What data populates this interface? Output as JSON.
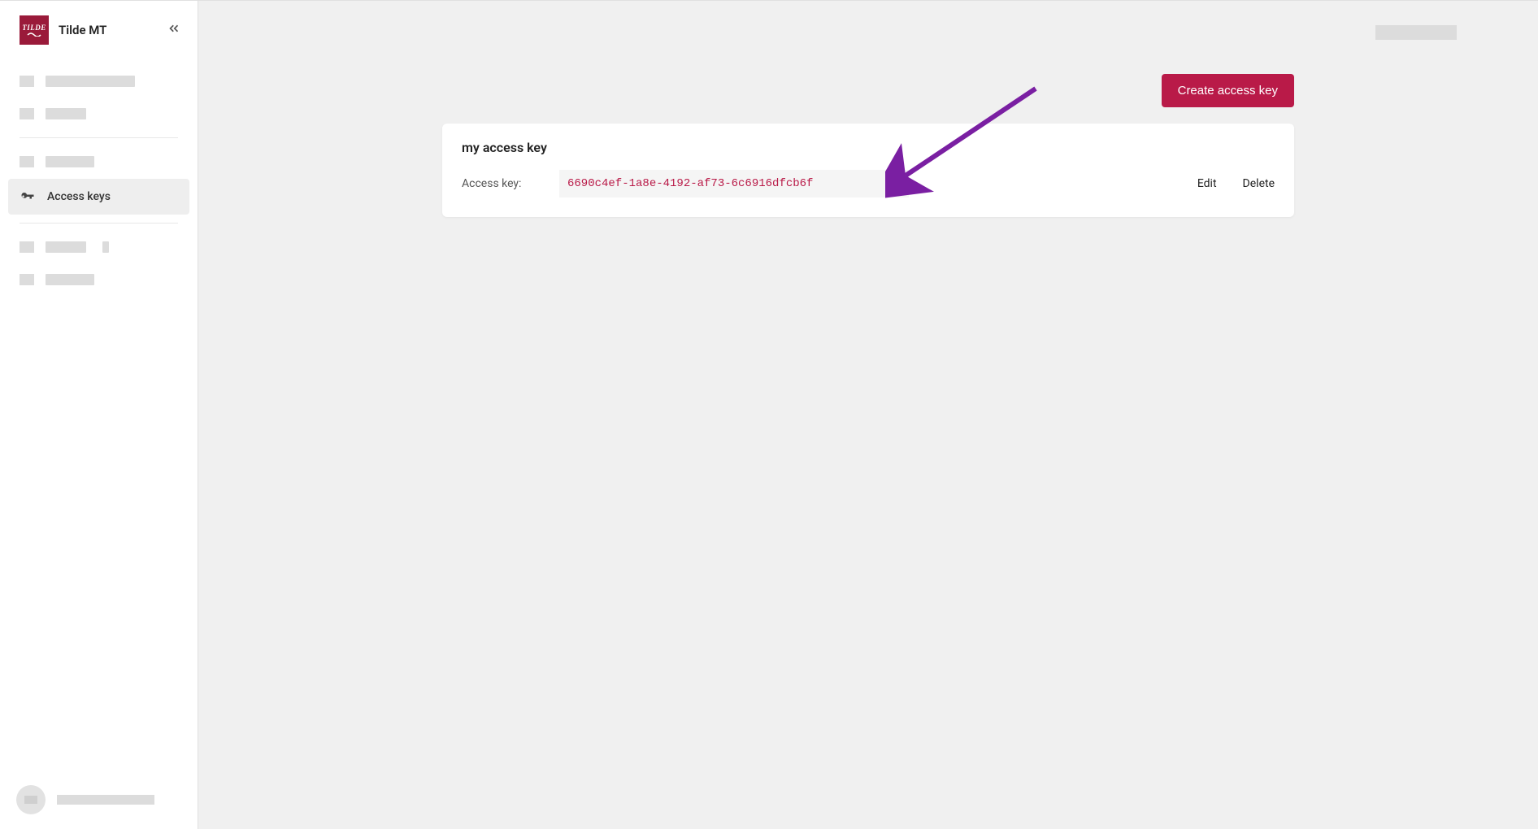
{
  "app": {
    "title": "Tilde MT",
    "logo_text": "TILDE"
  },
  "sidebar": {
    "access_keys_label": "Access keys"
  },
  "main": {
    "create_button": "Create access key",
    "card": {
      "title": "my access key",
      "label": "Access key:",
      "value": "6690c4ef-1a8e-4192-af73-6c6916dfcb6f",
      "edit": "Edit",
      "delete": "Delete"
    }
  },
  "colors": {
    "brand": "#9a1a3a",
    "accent": "#b91a48",
    "annotation": "#7a1fa2"
  }
}
